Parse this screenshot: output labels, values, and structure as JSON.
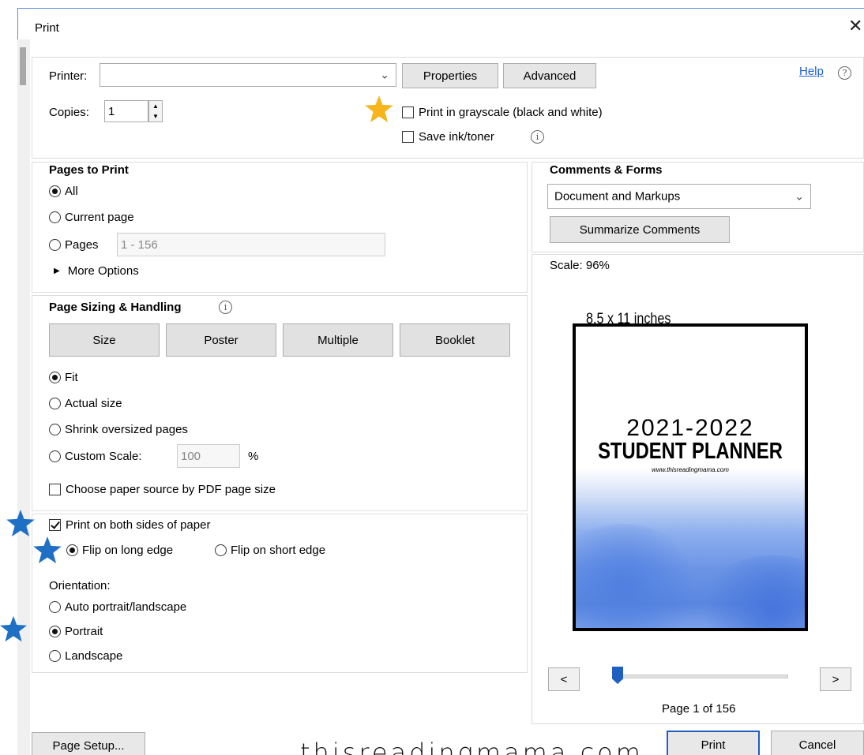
{
  "window": {
    "title": "Print",
    "close_glyph": "✕"
  },
  "printer": {
    "label": "Printer:",
    "value": "",
    "properties_label": "Properties",
    "advanced_label": "Advanced",
    "help_label": "Help",
    "copies_label": "Copies:",
    "copies_value": "1",
    "grayscale_label": "Print in grayscale (black and white)",
    "grayscale_checked": false,
    "save_ink_label": "Save ink/toner",
    "save_ink_checked": false
  },
  "pages_to_print": {
    "heading": "Pages to Print",
    "all_label": "All",
    "current_label": "Current page",
    "pages_label": "Pages",
    "pages_value": "1 - 156",
    "more_options_label": "More Options",
    "selected": "all"
  },
  "sizing": {
    "heading": "Page Sizing & Handling",
    "size_label": "Size",
    "poster_label": "Poster",
    "multiple_label": "Multiple",
    "booklet_label": "Booklet",
    "fit_label": "Fit",
    "actual_label": "Actual size",
    "shrink_label": "Shrink oversized pages",
    "custom_label": "Custom Scale:",
    "custom_value": "100",
    "percent_label": "%",
    "paper_source_label": "Choose paper source by PDF page size",
    "selected": "fit"
  },
  "duplex": {
    "both_sides_label": "Print on both sides of paper",
    "both_sides_checked": true,
    "long_edge_label": "Flip on long edge",
    "short_edge_label": "Flip on short edge",
    "selected": "long"
  },
  "orientation": {
    "heading": "Orientation:",
    "auto_label": "Auto portrait/landscape",
    "portrait_label": "Portrait",
    "landscape_label": "Landscape",
    "selected": "portrait"
  },
  "comments": {
    "heading": "Comments & Forms",
    "value": "Document and Markups",
    "summarize_label": "Summarize Comments"
  },
  "preview": {
    "scale_label": "Scale: 96%",
    "paper_size": "8.5 x 11 inches",
    "doc_line1": "2021-2022",
    "doc_line2": "STUDENT PLANNER",
    "doc_url": "www.thisreadingmama.com",
    "prev_label": "<",
    "next_label": ">",
    "page_label": "Page 1 of 156"
  },
  "footer": {
    "page_setup_label": "Page Setup...",
    "print_label": "Print",
    "cancel_label": "Cancel"
  },
  "watermark": "thisreadingmama.com",
  "colors": {
    "accent": "#1f5fbf",
    "star_gold": "#f5b51b",
    "star_blue": "#1f6fc4",
    "link": "#1a5fd1"
  },
  "icons": {
    "star": "star-icon",
    "info": "info-icon",
    "help": "help-icon",
    "chevron": "chevron-down-icon"
  }
}
